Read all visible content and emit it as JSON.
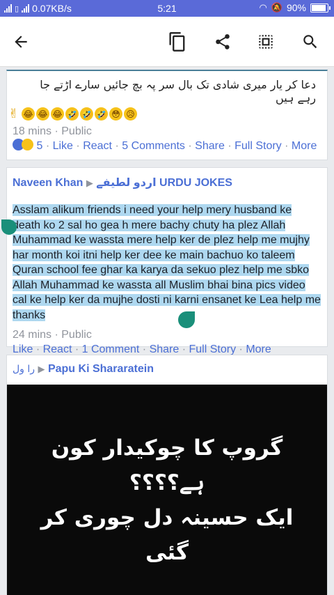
{
  "status_bar": {
    "net_speed": "0.07KB/s",
    "time": "5:21",
    "battery": "90%",
    "battery_level": 0.9
  },
  "toolbar": {
    "back_icon": "arrow-left-icon",
    "icons": [
      "copy-icon",
      "share-icon",
      "select-all-icon",
      "search-icon"
    ]
  },
  "post1": {
    "text": "دعا کر یار میری شادی تک بال سر پہ بچ جائیں سارے اڑتے جا رہے ہیں",
    "emojis": [
      "😥",
      "😳",
      "🤣",
      "🤣",
      "🤣",
      "😂",
      "😂",
      "😂",
      "✌"
    ],
    "meta": "18 mins · Public",
    "reactions_count": "5",
    "like": "Like",
    "react": "React",
    "comments": "5 Comments",
    "share": "Share",
    "full_story": "Full Story",
    "more": "More"
  },
  "post2": {
    "author": "Naveen Khan",
    "group": "اردو لطیفے URDU JOKES",
    "text": "Asslam alikum friends i need your help mery husband ke death ko 2 sal ho gea h mere bachy chuty ha plez Allah Muhammad ke wassta mere help ker de plez help me mujhy har month koi itni help ker dee ke main bachuo ko taleem Quran school fee ghar ka karya da sekuo plez help me sbko Allah Muhammad ke wassta all Muslim bhai bina pics video cal ke help ker da mujhe dosti ni karni ensanet ke Lea help me thanks",
    "meta": "24 mins · Public",
    "like": "Like",
    "react": "React",
    "comments": "1 Comment",
    "share": "Share",
    "full_story": "Full Story",
    "more": "More"
  },
  "post3": {
    "author": "را ول",
    "group": "Papu Ki Shararatein",
    "image_lines": [
      "گروپ کا چوکیدار کون",
      "ہے؟؟؟؟",
      "ایک حسینہ دل چوری کر",
      "گئی"
    ]
  }
}
